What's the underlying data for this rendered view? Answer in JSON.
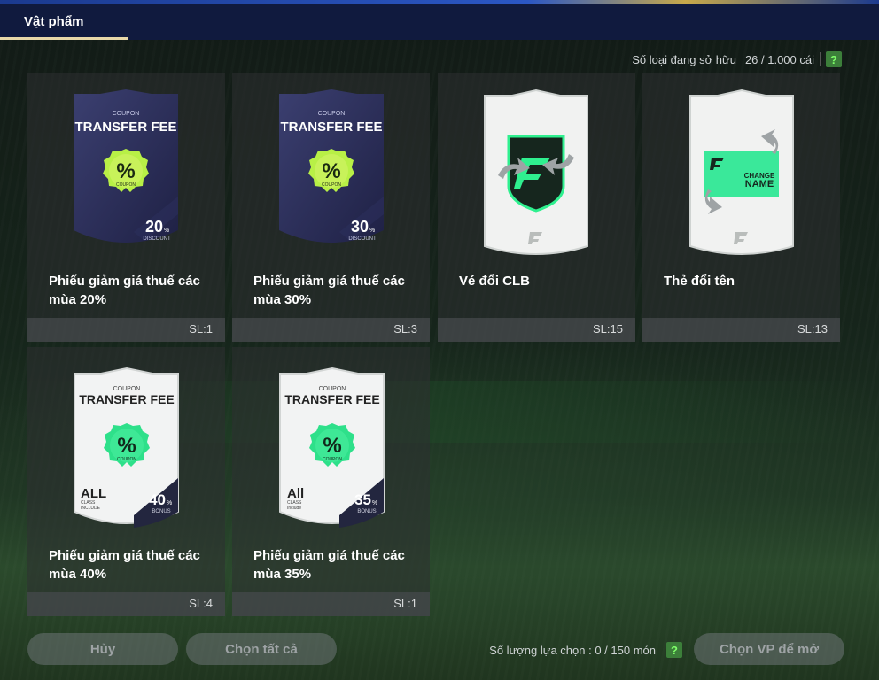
{
  "tabs": [
    {
      "label": "Vật phẩm",
      "active": true
    }
  ],
  "owned": {
    "label": "Số loại đang sở hữu",
    "value": "26 / 1.000 cái",
    "help": "?"
  },
  "coupon": {
    "small": "COUPON",
    "title": "TRANSFER FEE",
    "badge_symbol": "%",
    "badge_text": "COUPON",
    "discount_word": "DISCOUNT",
    "bonus_word": "BONUS"
  },
  "items": [
    {
      "name": "Phiếu giảm giá thuế các mùa 20%",
      "qty": "SL:1",
      "type": "coupon-dark",
      "pct": "20",
      "pct_sign": "%"
    },
    {
      "name": "Phiếu giảm giá thuế các mùa 30%",
      "qty": "SL:3",
      "type": "coupon-dark",
      "pct": "30",
      "pct_sign": "%"
    },
    {
      "name": "Vé đổi CLB",
      "qty": "SL:15",
      "type": "club-ticket"
    },
    {
      "name": "Thẻ đổi tên",
      "qty": "SL:13",
      "type": "name-card",
      "card_text_1": "CHANGE",
      "card_text_2": "NAME"
    },
    {
      "name": "Phiếu giảm giá thuế các mùa 40%",
      "qty": "SL:4",
      "type": "coupon-light",
      "pct": "40",
      "pct_sign": "%",
      "class_big": "ALL",
      "class_small_1": "CLASS",
      "class_small_2": "INCLUDE"
    },
    {
      "name": "Phiếu giảm giá thuế các mùa 35%",
      "qty": "SL:1",
      "type": "coupon-light",
      "pct": "35",
      "pct_sign": "%",
      "class_big": "All",
      "class_small_1": "CLASS",
      "class_small_2": "Include"
    }
  ],
  "footer": {
    "cancel_label": "Hủy",
    "select_all_label": "Chọn tất cả",
    "selection_label": "Số lượng lựa chọn : 0 / 150 món",
    "help": "?",
    "open_label": "Chọn VP để mở"
  },
  "colors": {
    "accent_green": "#3de08a",
    "lime": "#a6f03a",
    "tab_underline": "#e8d8a8"
  }
}
